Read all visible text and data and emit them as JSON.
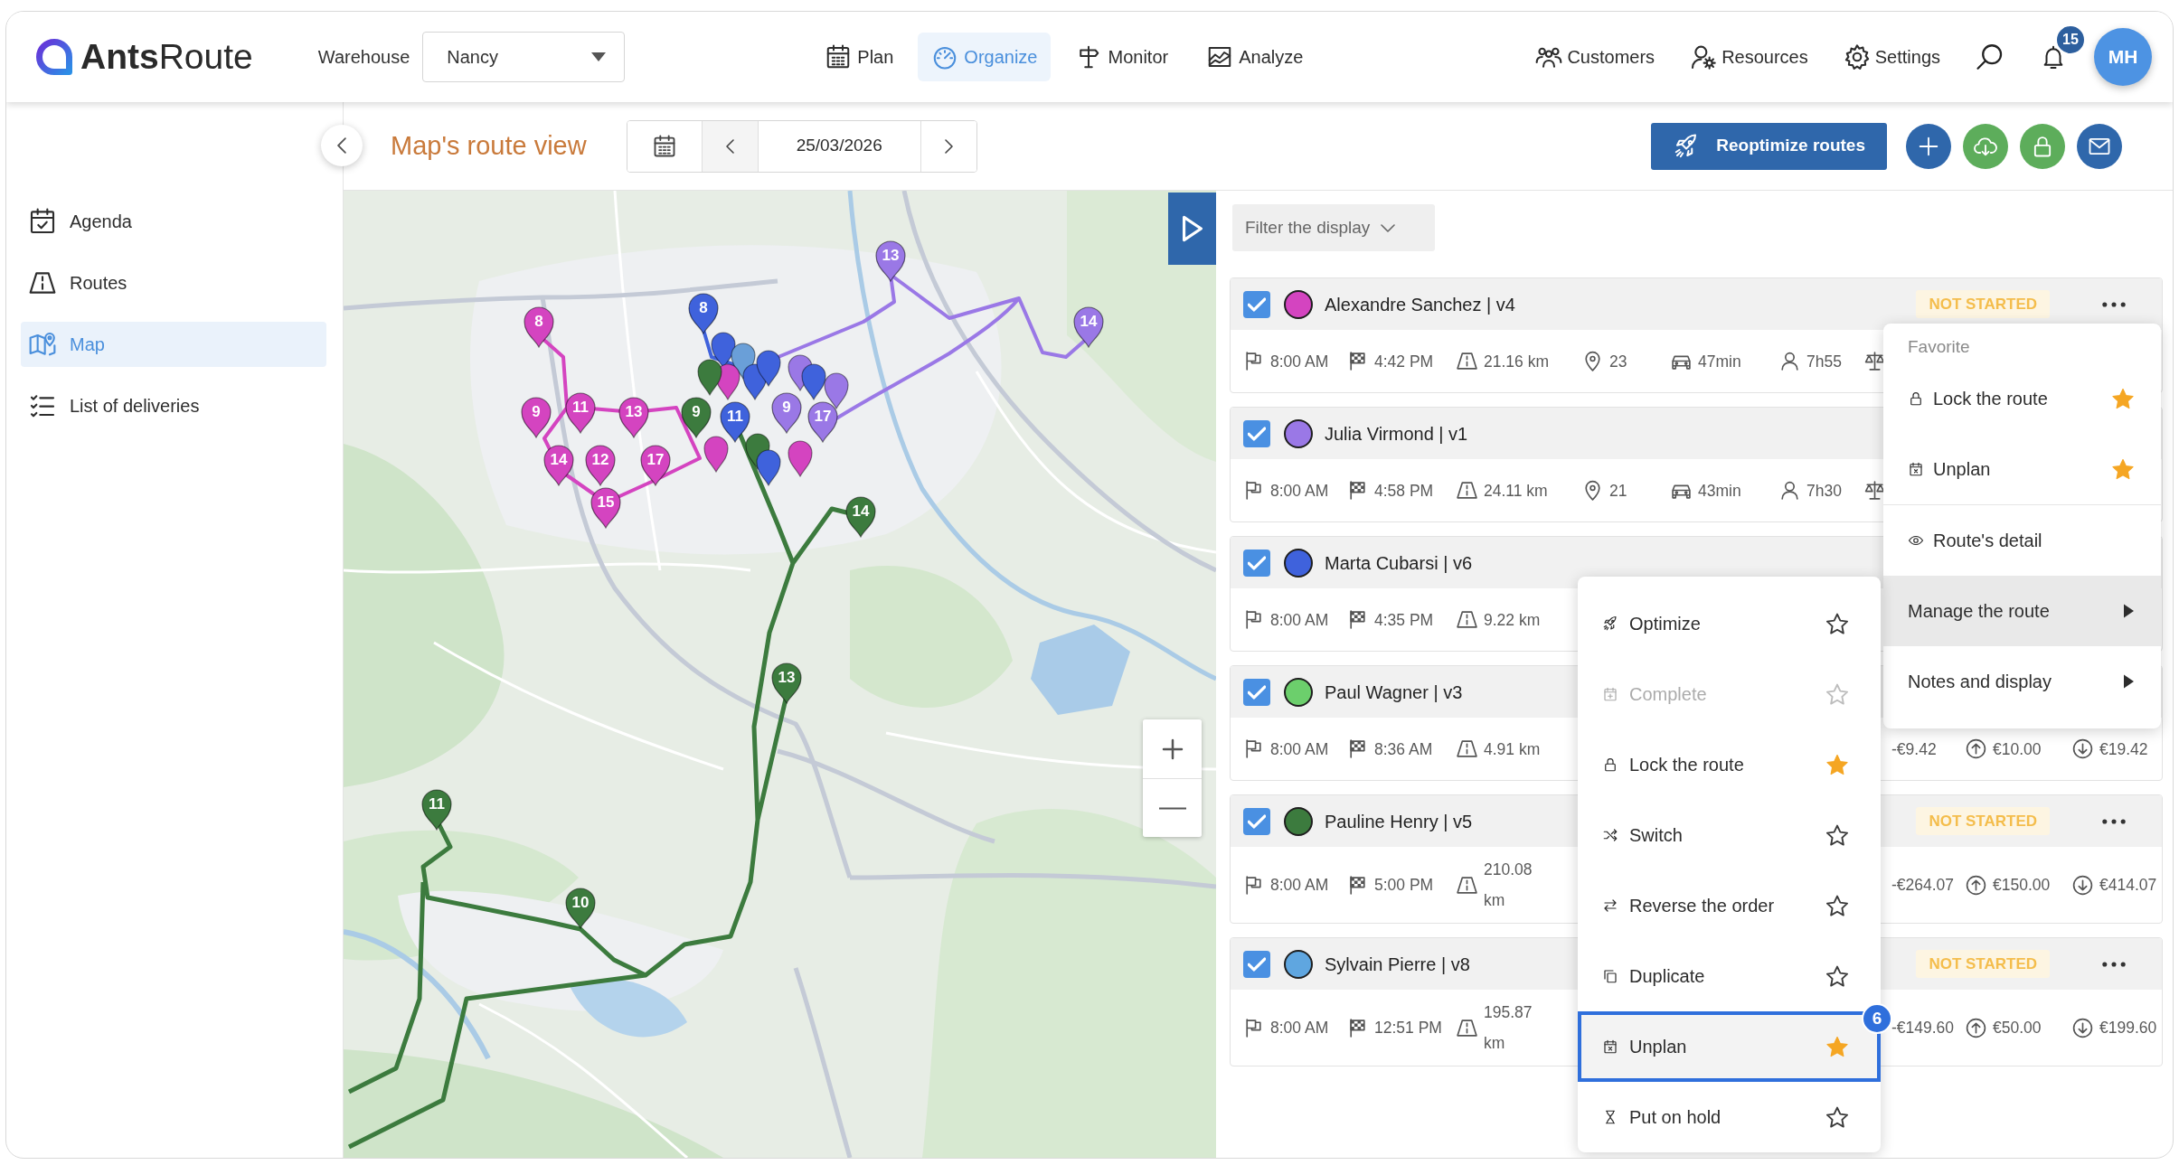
{
  "header": {
    "logo": "**Ants**Route",
    "warehouse": {
      "label": "Warehouse",
      "value": "Nancy"
    },
    "nav": [
      {
        "label": "Plan",
        "selected": false
      },
      {
        "label": "Organize",
        "selected": true
      },
      {
        "label": "Monitor",
        "selected": false
      },
      {
        "label": "Analyze",
        "selected": false
      }
    ],
    "links": [
      {
        "label": "Customers"
      },
      {
        "label": "Resources"
      },
      {
        "label": "Settings"
      }
    ],
    "notification_count": "15",
    "avatar": "MH"
  },
  "sidebar": {
    "items": [
      {
        "label": "Agenda",
        "selected": false
      },
      {
        "label": "Routes",
        "selected": false
      },
      {
        "label": "Map",
        "selected": true
      },
      {
        "label": "List of deliveries",
        "selected": false
      }
    ]
  },
  "toolbar": {
    "title": "Map's route view",
    "date": "25/03/2026",
    "reoptimize_button": "Reoptimize routes"
  },
  "map": {
    "pins": [
      {
        "label": "13",
        "color": "#9a78e6"
      },
      {
        "label": "8",
        "color": "#d444c0"
      },
      {
        "label": "8",
        "color": "#3f62dc"
      },
      {
        "label": "14",
        "color": "#9a78e6"
      },
      {
        "label": "9",
        "color": "#d444c0"
      },
      {
        "label": "11",
        "color": "#d444c0"
      },
      {
        "label": "13",
        "color": "#d444c0"
      },
      {
        "label": "9",
        "color": "#3c7b3e"
      },
      {
        "label": "11",
        "color": "#3f62dc"
      },
      {
        "label": "9",
        "color": "#9a78e6"
      },
      {
        "label": "17",
        "color": "#9a78e6"
      },
      {
        "label": "14",
        "color": "#d444c0"
      },
      {
        "label": "12",
        "color": "#d444c0"
      },
      {
        "label": "17",
        "color": "#d444c0"
      },
      {
        "label": "15",
        "color": "#d444c0"
      },
      {
        "label": "14",
        "color": "#3c7b3e"
      },
      {
        "label": "13",
        "color": "#3c7b3e"
      },
      {
        "label": "11",
        "color": "#3c7b3e"
      },
      {
        "label": "10",
        "color": "#3c7b3e"
      }
    ]
  },
  "route_panel": {
    "filter": "Filter the display",
    "routes": [
      {
        "name": "Alexandre Sanchez | v4",
        "checked": true,
        "color": "#d444c0",
        "status": "NOT STARTED",
        "stats": [
          {
            "kind": "start",
            "value": "8:00 AM"
          },
          {
            "kind": "end",
            "value": "4:42 PM"
          },
          {
            "kind": "distance",
            "value": "21.16 km"
          },
          {
            "kind": "stops",
            "value": "23"
          },
          {
            "kind": "drive",
            "value": "47min"
          },
          {
            "kind": "work",
            "value": "7h55"
          },
          {
            "kind": "balance"
          }
        ]
      },
      {
        "name": "Julia Virmond | v1",
        "checked": true,
        "color": "#9a78e6",
        "stats": [
          {
            "kind": "start",
            "value": "8:00 AM"
          },
          {
            "kind": "end",
            "value": "4:58 PM"
          },
          {
            "kind": "distance",
            "value": "24.11 km"
          },
          {
            "kind": "stops",
            "value": "21"
          },
          {
            "kind": "drive",
            "value": "43min"
          },
          {
            "kind": "work",
            "value": "7h30"
          },
          {
            "kind": "balance"
          }
        ]
      },
      {
        "name": "Marta Cubarsi | v6",
        "checked": true,
        "color": "#3f62dc",
        "stats": [
          {
            "kind": "start",
            "value": "8:00 AM"
          },
          {
            "kind": "end",
            "value": "4:35 PM"
          },
          {
            "kind": "distance",
            "value": "9.22 km"
          }
        ]
      },
      {
        "name": "Paul Wagner | v3",
        "checked": true,
        "color": "#6ccf6c",
        "stats": [
          {
            "kind": "start",
            "value": "8:00 AM"
          },
          {
            "kind": "end",
            "value": "8:36 AM"
          },
          {
            "kind": "distance",
            "value": "4.91 km"
          },
          {
            "kind": "balance",
            "value": "-€9.42"
          },
          {
            "kind": "revenue",
            "value": "€10.00"
          },
          {
            "kind": "cost",
            "value": "€19.42"
          }
        ]
      },
      {
        "name": "Pauline Henry | v5",
        "checked": true,
        "color": "#3c7b3e",
        "status": "NOT STARTED",
        "stats": [
          {
            "kind": "start",
            "value": "8:00 AM"
          },
          {
            "kind": "end",
            "value": "5:00 PM"
          },
          {
            "kind": "distance",
            "value": "210.08 km"
          },
          {
            "kind": "balance",
            "value": "-€264.07"
          },
          {
            "kind": "revenue",
            "value": "€150.00"
          },
          {
            "kind": "cost",
            "value": "€414.07"
          }
        ]
      },
      {
        "name": "Sylvain Pierre | v8",
        "checked": true,
        "color": "#5fa6e0",
        "status": "NOT STARTED",
        "stats": [
          {
            "kind": "start",
            "value": "8:00 AM"
          },
          {
            "kind": "end",
            "value": "12:51 PM"
          },
          {
            "kind": "distance",
            "value": "195.87 km"
          },
          {
            "kind": "balance",
            "value": "-€149.60"
          },
          {
            "kind": "revenue",
            "value": "€50.00"
          },
          {
            "kind": "cost",
            "value": "€199.60"
          }
        ]
      }
    ]
  },
  "route_menu": {
    "heading": "Favorite",
    "favorites": [
      {
        "label": "Lock the route",
        "favorite": true
      },
      {
        "label": "Unplan",
        "favorite": true
      }
    ],
    "items": [
      {
        "kind": "action",
        "label": "Route's detail",
        "selected": false
      },
      {
        "kind": "submenu",
        "label": "Manage the route",
        "selected": true
      },
      {
        "kind": "submenu",
        "label": "Notes and display",
        "selected": false
      }
    ]
  },
  "manage_submenu": {
    "items": [
      {
        "label": "Optimize",
        "favorite": false,
        "disabled": false,
        "highlighted": false
      },
      {
        "label": "Complete",
        "favorite": false,
        "disabled": true,
        "highlighted": false
      },
      {
        "label": "Lock the route",
        "favorite": true,
        "disabled": false,
        "highlighted": false
      },
      {
        "label": "Switch",
        "favorite": false,
        "disabled": false,
        "highlighted": false
      },
      {
        "label": "Reverse the order",
        "favorite": false,
        "disabled": false,
        "highlighted": false
      },
      {
        "label": "Duplicate",
        "favorite": false,
        "disabled": false,
        "highlighted": false
      },
      {
        "label": "Unplan",
        "favorite": true,
        "disabled": false,
        "highlighted": true,
        "badge": "6"
      },
      {
        "label": "Put on hold",
        "favorite": false,
        "disabled": false,
        "highlighted": false
      }
    ]
  }
}
